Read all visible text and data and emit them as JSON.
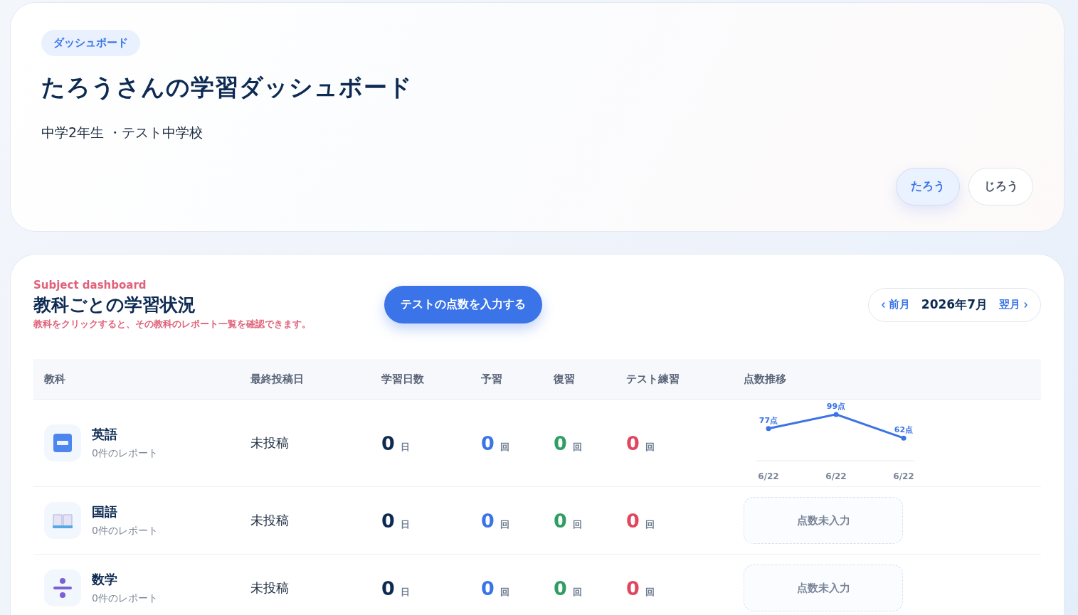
{
  "header": {
    "badge": "ダッシュボード",
    "title": "たろうさんの学習ダッシュボード",
    "subtitle": "中学2年生 ・テスト中学校",
    "students": [
      {
        "label": "たろう",
        "selected": true
      },
      {
        "label": "じろう",
        "selected": false
      }
    ]
  },
  "subjects": {
    "eyebrow": "Subject dashboard",
    "title": "教科ごとの学習状況",
    "hint": "教科をクリックすると、その教科のレポート一覧を確認できます。",
    "action": "テストの点数を入力する",
    "month": {
      "prev": "前月",
      "current": "2026年7月",
      "next": "翌月"
    },
    "columns": [
      "教科",
      "最終投稿日",
      "学習日数",
      "予習",
      "復習",
      "テスト練習",
      "点数推移"
    ],
    "rows": [
      {
        "name": "英語",
        "reports": "0件のレポート",
        "last_post": "未投稿",
        "days": "0",
        "days_unit": "日",
        "prep": "0",
        "prep_unit": "回",
        "review": "0",
        "review_unit": "回",
        "test": "0",
        "test_unit": "回",
        "kind": "chart",
        "chart_data": {
          "type": "line",
          "categories": [
            "6/22",
            "6/22",
            "6/22"
          ],
          "series": [
            {
              "color": "#3b73e6",
              "marker": "o",
              "values": [
                77,
                99,
                62
              ],
              "value_labels": [
                "77点",
                "99点",
                "62点"
              ]
            }
          ]
        }
      },
      {
        "name": "国語",
        "reports": "0件のレポート",
        "last_post": "未投稿",
        "days": "0",
        "days_unit": "日",
        "prep": "0",
        "prep_unit": "回",
        "review": "0",
        "review_unit": "回",
        "test": "0",
        "test_unit": "回",
        "kind": "empty",
        "empty_text": "点数未入力"
      },
      {
        "name": "数学",
        "reports": "0件のレポート",
        "last_post": "未投稿",
        "days": "0",
        "days_unit": "日",
        "prep": "0",
        "prep_unit": "回",
        "review": "0",
        "review_unit": "回",
        "test": "0",
        "test_unit": "回",
        "kind": "empty",
        "empty_text": "点数未入力"
      }
    ]
  }
}
